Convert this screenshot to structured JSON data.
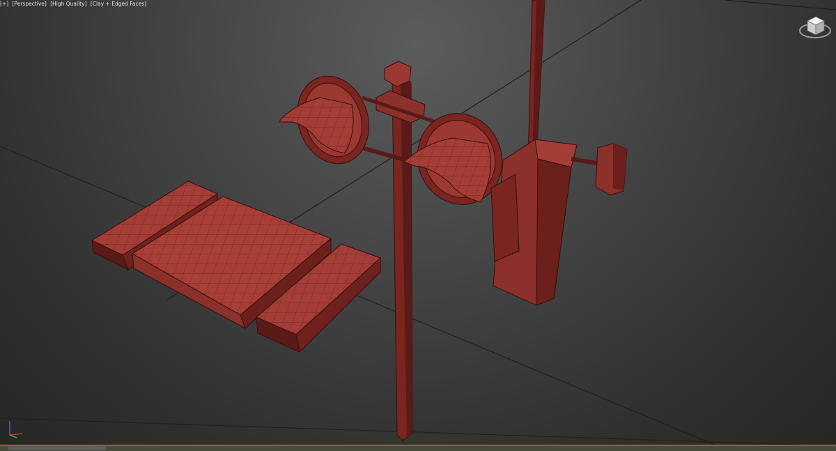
{
  "viewport": {
    "labels": {
      "menu": "[+]",
      "view": "[Perspective]",
      "quality": "[High Quality]",
      "shading": "[Clay + Edged Faces]"
    }
  },
  "colors": {
    "background": "#404040",
    "grid_line": "#1e1e1e",
    "clay_face": "#8c302b",
    "clay_dark": "#5e1d1a",
    "clay_light": "#b5493f",
    "edge": "#3a0d0b",
    "timeline_accent": "#c7a33c"
  },
  "icons": {
    "viewcube": "viewcube-icon",
    "axis": "axis-tripod-icon"
  }
}
